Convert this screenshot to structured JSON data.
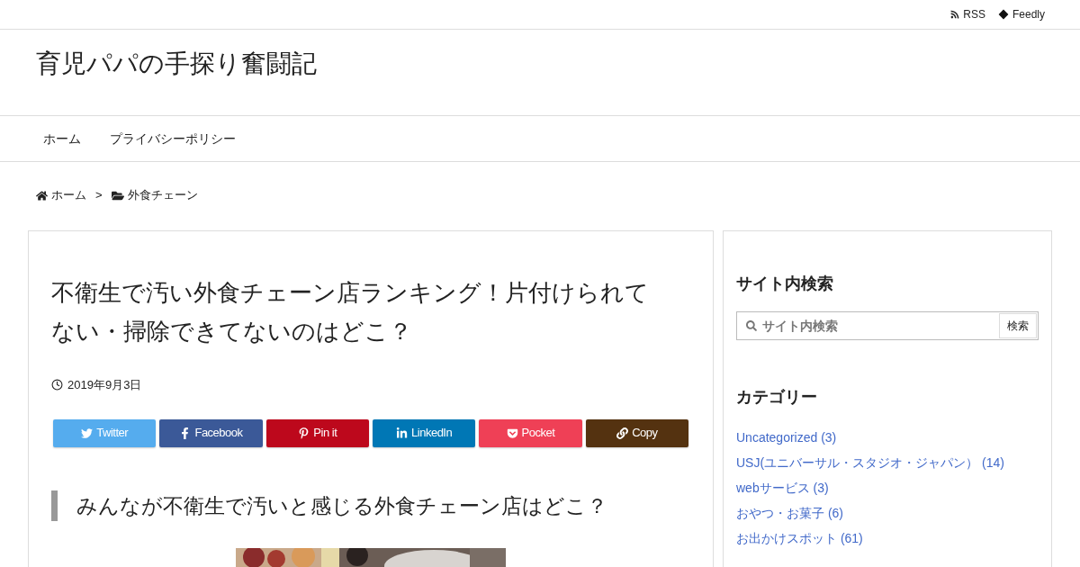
{
  "top_links": [
    {
      "kind": "rss",
      "label": "RSS"
    },
    {
      "kind": "feedly",
      "label": "Feedly"
    }
  ],
  "site_title": "育児パパの手探り奮闘記",
  "nav": [
    "ホーム",
    "プライバシーポリシー"
  ],
  "breadcrumb": [
    {
      "kind": "home",
      "label": "ホーム"
    },
    {
      "kind": "sep",
      "label": ">"
    },
    {
      "kind": "folder",
      "label": "外食チェーン"
    }
  ],
  "article": {
    "title": "不衛生で汚い外食チェーン店ランキング！片付けられてない・掃除できてないのはどこ？",
    "date": "2019年9月3日",
    "share": [
      {
        "kind": "twitter",
        "label": "Twitter",
        "color": "#55acee"
      },
      {
        "kind": "facebook",
        "label": "Facebook",
        "color": "#3b5998"
      },
      {
        "kind": "pinterest",
        "label": "Pin it",
        "color": "#bd081c"
      },
      {
        "kind": "linkedin",
        "label": "LinkedIn",
        "color": "#0077b5"
      },
      {
        "kind": "pocket",
        "label": "Pocket",
        "color": "#ef4056"
      },
      {
        "kind": "copy",
        "label": "Copy",
        "color": "#543210"
      }
    ],
    "heading": "みんなが不衛生で汚いと感じる外食チェーン店はどこ？"
  },
  "sidebar": {
    "search_title": "サイト内検索",
    "search": {
      "placeholder": "サイト内検索",
      "button": "検索"
    },
    "category_title": "カテゴリー",
    "categories": [
      "Uncategorized (3)",
      "USJ(ユニバーサル・スタジオ・ジャパン） (14)",
      "webサービス (3)",
      "おやつ・お菓子 (6)",
      "お出かけスポット (61)"
    ]
  }
}
